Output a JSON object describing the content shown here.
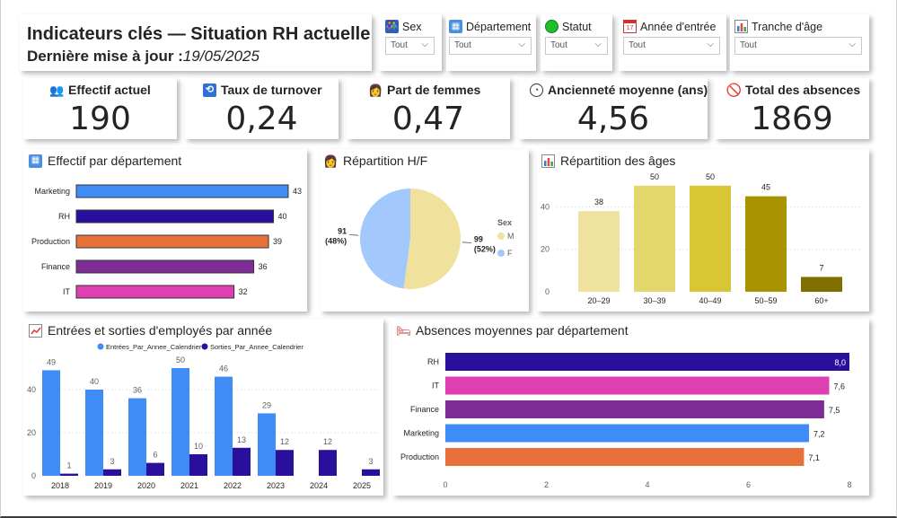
{
  "header": {
    "title": "Indicateurs clés — Situation RH actuelle",
    "updated_label": "Dernière mise à jour :",
    "updated_date": "19/05/2025"
  },
  "slicers": [
    {
      "label": "Sex",
      "value": "Tout",
      "icon": "people-icon"
    },
    {
      "label": "Département",
      "value": "Tout",
      "icon": "building-icon"
    },
    {
      "label": "Statut",
      "value": "Tout",
      "icon": "green-circle-icon"
    },
    {
      "label": "Année d'entrée",
      "value": "Tout",
      "icon": "calendar-icon"
    },
    {
      "label": "Tranche d'âge",
      "value": "Tout",
      "icon": "bar-chart-icon"
    }
  ],
  "kpis": [
    {
      "label": "Effectif actuel",
      "value": "190",
      "icon": "people-icon"
    },
    {
      "label": "Taux de turnover",
      "value": "0,24",
      "icon": "refresh-icon"
    },
    {
      "label": "Part de femmes",
      "value": "0,47",
      "icon": "woman-icon"
    },
    {
      "label": "Ancienneté moyenne (ans)",
      "value": "4,56",
      "icon": "clock-icon"
    },
    {
      "label": "Total des absences",
      "value": "1869",
      "icon": "prohibited-icon"
    }
  ],
  "visual_titles": {
    "dept": "Effectif par département",
    "gender": "Répartition H/F",
    "ages": "Répartition des âges",
    "flows": "Entrées et sorties d'employés par année",
    "absences": "Absences moyennes par département"
  },
  "colors": {
    "blue": "#3f8cf7",
    "navy": "#2a0f9c",
    "orange": "#e8703a",
    "purple": "#7e2c98",
    "pink": "#de3fb1",
    "pie_m": "#f0e29c",
    "pie_f": "#a3c9fc"
  },
  "chart_data": [
    {
      "id": "dept",
      "type": "bar",
      "orientation": "horizontal",
      "categories": [
        "Marketing",
        "RH",
        "Production",
        "Finance",
        "IT"
      ],
      "values": [
        43,
        40,
        39,
        36,
        32
      ],
      "colors": [
        "#3f8cf7",
        "#2a0f9c",
        "#e8703a",
        "#7e2c98",
        "#de3fb1"
      ]
    },
    {
      "id": "gender",
      "type": "pie",
      "legend_title": "Sex",
      "slices": [
        {
          "name": "M",
          "value": 99,
          "percent": "(52%)",
          "color": "#f0e29c"
        },
        {
          "name": "F",
          "value": 91,
          "percent": "(48%)",
          "color": "#a3c9fc"
        }
      ]
    },
    {
      "id": "ages",
      "type": "bar",
      "categories": [
        "20–29",
        "30–39",
        "40–49",
        "50–59",
        "60+"
      ],
      "values": [
        38,
        50,
        50,
        45,
        7
      ],
      "yticks": [
        0,
        20,
        40
      ],
      "ylim": [
        0,
        55
      ],
      "colors": [
        "#efe29e",
        "#e3d66b",
        "#d9c634",
        "#a89400",
        "#7e6f00"
      ]
    },
    {
      "id": "flows",
      "type": "bar",
      "categories": [
        "2018",
        "2019",
        "2020",
        "2021",
        "2022",
        "2023",
        "2024",
        "2025"
      ],
      "series": [
        {
          "name": "Entrées_Par_Annee_Calendrier",
          "values": [
            49,
            40,
            36,
            50,
            46,
            29,
            null,
            null
          ],
          "color": "#3f8cf7"
        },
        {
          "name": "Sorties_Par_Annee_Calendrier",
          "values": [
            1,
            3,
            6,
            10,
            13,
            12,
            12,
            3
          ],
          "color": "#2a0f9c"
        }
      ],
      "yticks": [
        0,
        20,
        40
      ],
      "ylim": [
        0,
        55
      ]
    },
    {
      "id": "absences",
      "type": "bar",
      "orientation": "horizontal",
      "categories": [
        "RH",
        "IT",
        "Finance",
        "Marketing",
        "Production"
      ],
      "values": [
        8.0,
        7.6,
        7.5,
        7.2,
        7.1
      ],
      "labels": [
        "8,0",
        "7,6",
        "7,5",
        "7,2",
        "7,1"
      ],
      "colors": [
        "#2a0f9c",
        "#de3fb1",
        "#7e2c98",
        "#3f8cf7",
        "#e8703a"
      ],
      "xticks": [
        0,
        2,
        4,
        6,
        8
      ],
      "xlim": [
        0,
        8
      ]
    }
  ]
}
